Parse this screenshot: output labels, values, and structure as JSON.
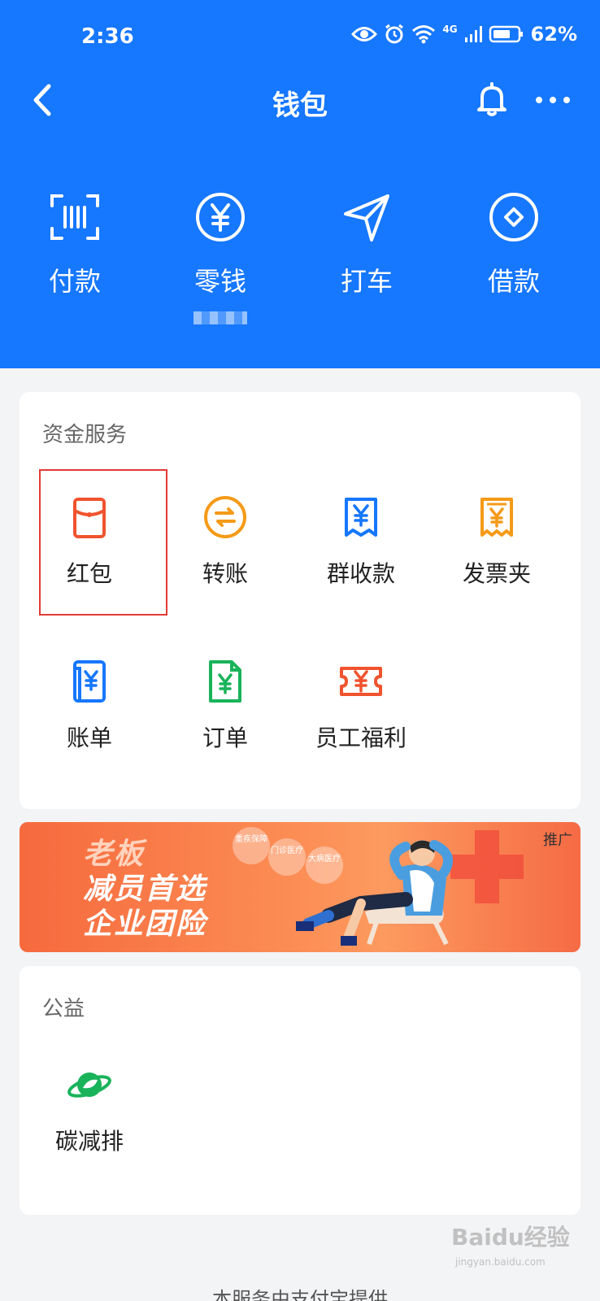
{
  "status_bar": {
    "time": "2:36",
    "battery": "62%",
    "network": "4G"
  },
  "nav": {
    "title": "钱包"
  },
  "quick_actions": [
    {
      "label": "付款",
      "icon": "scan-pay-icon"
    },
    {
      "label": "零钱",
      "icon": "yuan-coin-icon"
    },
    {
      "label": "打车",
      "icon": "navigation-arrow-icon"
    },
    {
      "label": "借款",
      "icon": "loan-diamond-icon"
    }
  ],
  "fund_services": {
    "title": "资金服务",
    "items": [
      {
        "label": "红包",
        "icon": "red-envelope-icon",
        "color": "#f0532e"
      },
      {
        "label": "转账",
        "icon": "transfer-icon",
        "color": "#f59a18"
      },
      {
        "label": "群收款",
        "icon": "group-collect-icon",
        "color": "#1677ff"
      },
      {
        "label": "发票夹",
        "icon": "invoice-folder-icon",
        "color": "#f59a18"
      },
      {
        "label": "账单",
        "icon": "bill-icon",
        "color": "#1677ff"
      },
      {
        "label": "订单",
        "icon": "order-icon",
        "color": "#19b35a"
      },
      {
        "label": "员工福利",
        "icon": "employee-benefit-icon",
        "color": "#f0532e"
      }
    ]
  },
  "banner": {
    "line1": "老板",
    "line2": "减员首选",
    "line3": "企业团险",
    "tag": "推广",
    "bubbles": [
      "重疾保障",
      "门诊医疗",
      "大病医疗"
    ]
  },
  "charity": {
    "title": "公益",
    "items": [
      {
        "label": "碳减排",
        "icon": "planet-leaf-icon",
        "color": "#19b35a"
      }
    ]
  },
  "footer": {
    "text": "本服务由支付宝提供"
  },
  "watermark": {
    "text": "Baidu经验",
    "sub": "jingyan.baidu.com"
  },
  "colors": {
    "brand_blue": "#1677ff",
    "highlight_red": "#e33b35",
    "background": "#f3f4f6"
  }
}
